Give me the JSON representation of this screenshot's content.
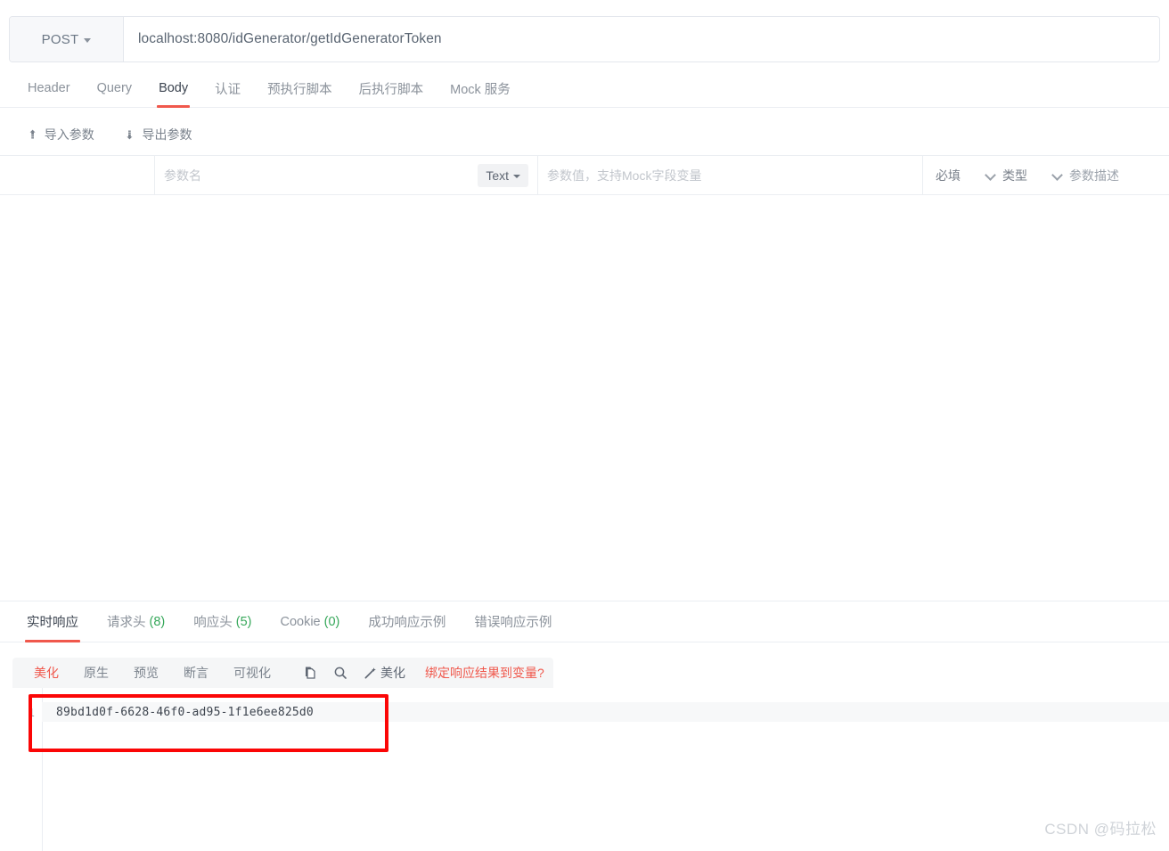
{
  "request": {
    "method": "POST",
    "method_caret_icon": "caret-down-icon",
    "url": "localhost:8080/idGenerator/getIdGeneratorToken",
    "tabs": [
      {
        "label": "Header",
        "active": false
      },
      {
        "label": "Query",
        "active": false
      },
      {
        "label": "Body",
        "active": true
      },
      {
        "label": "认证",
        "active": false
      },
      {
        "label": "预执行脚本",
        "active": false
      },
      {
        "label": "后执行脚本",
        "active": false
      },
      {
        "label": "Mock 服务",
        "active": false
      }
    ],
    "toolbar": {
      "import_icon": "arrow-up-icon",
      "import_label": "导入参数",
      "export_icon": "arrow-down-icon",
      "export_label": "导出参数"
    },
    "param_table": {
      "name_placeholder": "参数名",
      "type_pill_label": "Text",
      "type_pill_icon": "caret-down-icon",
      "value_placeholder": "参数值，支持Mock字段变量",
      "required_label": "必填",
      "required_icon": "chevron-down-icon",
      "type_label": "类型",
      "type_icon": "chevron-down-icon",
      "description_placeholder": "参数描述"
    }
  },
  "response": {
    "tabs": [
      {
        "label": "实时响应",
        "count": "",
        "active": true
      },
      {
        "label": "请求头",
        "count": "(8)",
        "active": false
      },
      {
        "label": "响应头",
        "count": "(5)",
        "active": false
      },
      {
        "label": "Cookie",
        "count": "(0)",
        "active": false
      },
      {
        "label": "成功响应示例",
        "count": "",
        "active": false
      },
      {
        "label": "错误响应示例",
        "count": "",
        "active": false
      }
    ],
    "subtabs": [
      {
        "label": "美化",
        "active": true
      },
      {
        "label": "原生",
        "active": false
      },
      {
        "label": "预览",
        "active": false
      },
      {
        "label": "断言",
        "active": false
      },
      {
        "label": "可视化",
        "active": false
      }
    ],
    "actions": {
      "copy_icon": "copy-icon",
      "search_icon": "search-icon",
      "wand_icon": "magic-wand-icon",
      "wand_label": "美化",
      "bind_link": "绑定响应结果到变量?"
    },
    "body": {
      "line_number": "1",
      "content": "89bd1d0f-6628-46f0-ad95-1f1e6ee825d0"
    }
  },
  "annotation": {
    "highlight_color": "#fb0606"
  },
  "watermark": "CSDN @码拉松",
  "colors": {
    "accent": "#f0584c",
    "count_green": "#37a85b",
    "border": "#ebeef2"
  }
}
